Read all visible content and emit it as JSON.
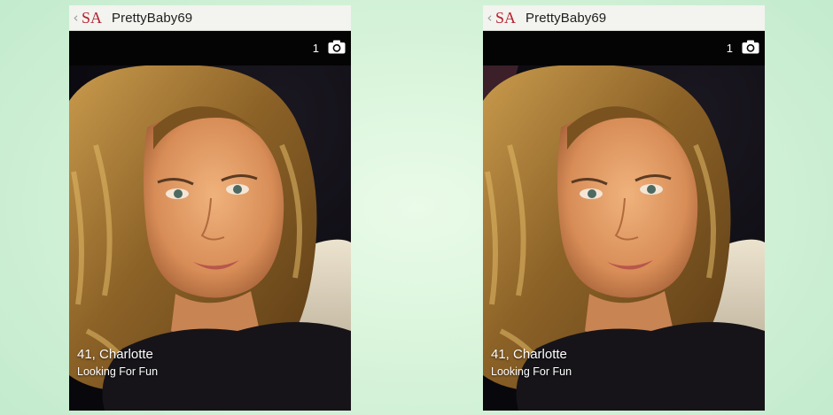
{
  "panels": [
    {
      "header": {
        "logo": "SA",
        "username": "PrettyBaby69",
        "back_icon": "chevron-left-icon"
      },
      "photo_bar": {
        "count": "1",
        "camera_icon": "camera-icon"
      },
      "profile": {
        "name_line": "41, Charlotte",
        "tagline": "Looking For Fun"
      }
    },
    {
      "header": {
        "logo": "SA",
        "username": "PrettyBaby69",
        "back_icon": "chevron-left-icon"
      },
      "photo_bar": {
        "count": "1",
        "camera_icon": "camera-icon"
      },
      "profile": {
        "name_line": "41, Charlotte",
        "tagline": "Looking For Fun"
      }
    }
  ],
  "colors": {
    "background": "#d6f3d9",
    "header_bg": "#f3f3ef",
    "logo_red": "#b3222f",
    "photo_bar_bg": "#040404"
  }
}
